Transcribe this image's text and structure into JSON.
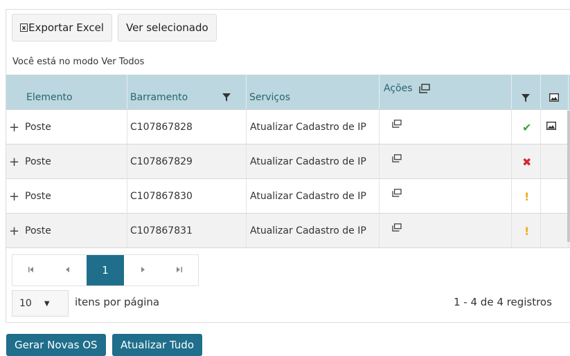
{
  "toolbar": {
    "export_icon": "excel-icon",
    "export_label": "Exportar Excel",
    "view_selected_label": "Ver selecionado"
  },
  "mode_text": "Você está no modo Ver Todos",
  "grid": {
    "columns": {
      "elemento": "Elemento",
      "barramento": "Barramento",
      "servicos": "Serviços",
      "acoes": "Ações"
    },
    "rows": [
      {
        "elemento": "Poste",
        "barramento": "C107867828",
        "servico": "Atualizar Cadastro de IP",
        "status": "ok",
        "status_symbol": "✔",
        "has_image": true
      },
      {
        "elemento": "Poste",
        "barramento": "C107867829",
        "servico": "Atualizar Cadastro de IP",
        "status": "error",
        "status_symbol": "✖",
        "has_image": false
      },
      {
        "elemento": "Poste",
        "barramento": "C107867830",
        "servico": "Atualizar Cadastro de IP",
        "status": "warning",
        "status_symbol": "!",
        "has_image": false
      },
      {
        "elemento": "Poste",
        "barramento": "C107867831",
        "servico": "Atualizar Cadastro de IP",
        "status": "warning",
        "status_symbol": "!",
        "has_image": false
      }
    ]
  },
  "pager": {
    "current_page": "1",
    "page_size": "10",
    "per_page_label": "itens por página",
    "range_text": "1 - 4 de 4 registros"
  },
  "footer": {
    "generate_label": "Gerar Novas OS",
    "update_all_label": "Atualizar Tudo"
  },
  "colors": {
    "header_bg": "#bcd7df",
    "header_text": "#2a6374",
    "primary": "#1f6e8b",
    "ok": "#3aa53a",
    "error": "#d9262c",
    "warning": "#f0ad1e"
  }
}
